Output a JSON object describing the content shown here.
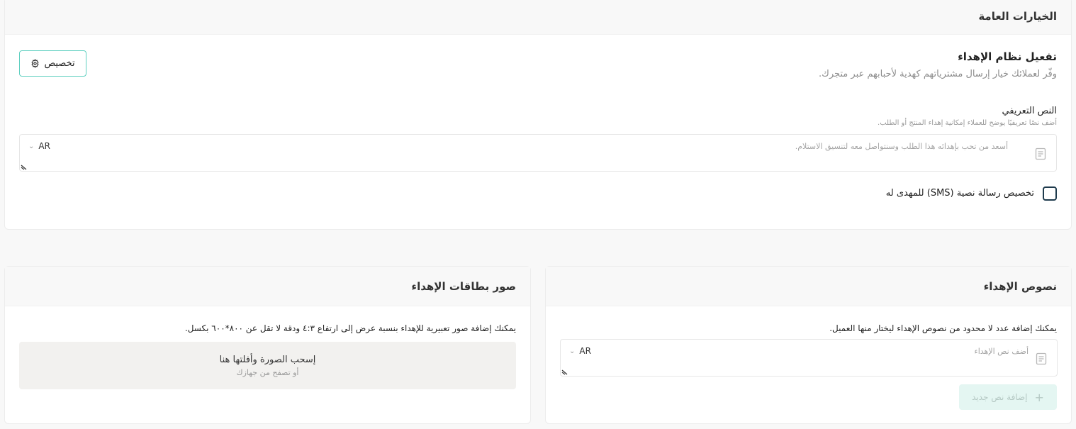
{
  "general": {
    "section_title": "الخيارات العامة",
    "gifting_title": "تفعيل نظام الإهداء",
    "gifting_desc": "وفّر لعملائك خيار إرسال مشترياتهم كهدية لأحبابهم عبر متجرك.",
    "customize_label": "تخصيص",
    "intro_label": "النص التعريفي",
    "intro_hint": "أضف نصًا تعريفيًا يوضح للعملاء إمكانية إهداء المنتج أو الطلب.",
    "intro_placeholder": "أسعد من تحب بإهدائه هذا الطلب وسنتواصل معه لتنسيق الاستلام.",
    "intro_lang": "AR",
    "sms_label": "تخصيص رسالة نصية (SMS) للمهدى له"
  },
  "gift_texts": {
    "title": "نصوص الإهداء",
    "desc": "يمكنك إضافة عدد لا محدود من نصوص الإهداء ليختار منها العميل.",
    "placeholder": "أضف نص الإهداء",
    "lang": "AR",
    "add_label": "إضافة نص جديد"
  },
  "gift_images": {
    "title": "صور بطاقات الإهداء",
    "desc": "يمكنك إضافة صور تعبيرية للإهداء بنسبة عرض إلى ارتفاع ٤:٣ ودقة لا تقل عن ٨٠٠*٦٠٠ بكسل.",
    "drop_title": "إسحب الصورة وأفلتها هنا",
    "drop_sub": "أو تصفح من جهازك"
  },
  "colors": {
    "accent_border": "#5fd0c0",
    "add_button_bg": "#e4f6f2",
    "checkbox_border": "#1f3b4d"
  },
  "icons": [
    "gear-icon",
    "document-icon",
    "chevron-down-icon",
    "resize-icon",
    "plus-icon"
  ]
}
